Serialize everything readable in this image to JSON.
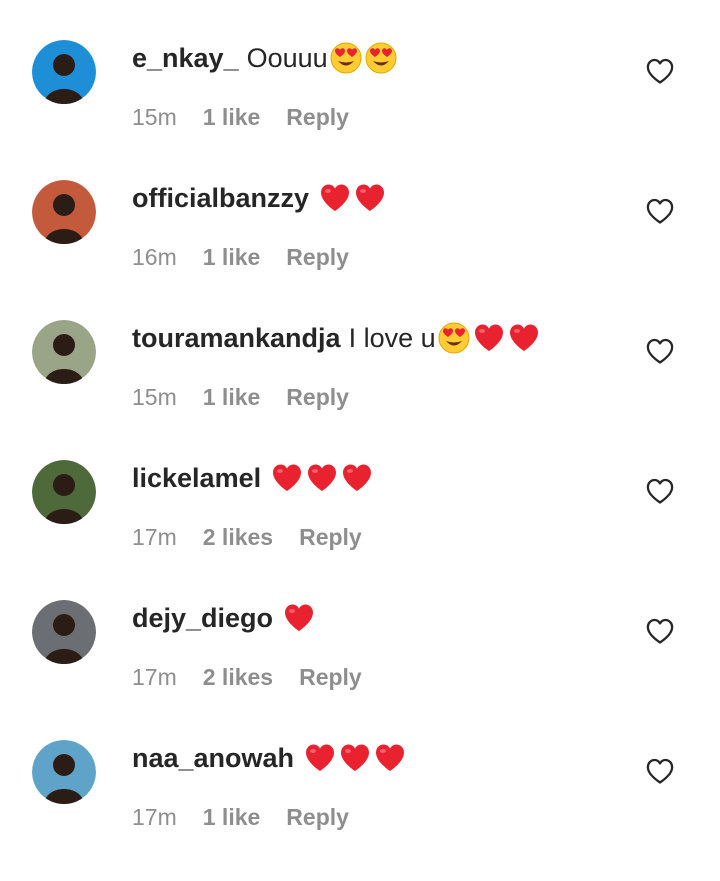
{
  "comments": [
    {
      "username": "e_nkay_",
      "text": "Oouuu",
      "emojis": [
        "heart-eyes",
        "heart-eyes"
      ],
      "time": "15m",
      "likes": "1 like",
      "reply": "Reply",
      "avatar_bg": "#1e8fd6"
    },
    {
      "username": "officialbanzzy",
      "text": "",
      "emojis": [
        "heart",
        "heart"
      ],
      "time": "16m",
      "likes": "1 like",
      "reply": "Reply",
      "avatar_bg": "#c45a3c"
    },
    {
      "username": "touramankandja",
      "text": "I love u",
      "emojis": [
        "heart-eyes",
        "heart",
        "heart"
      ],
      "time": "15m",
      "likes": "1 like",
      "reply": "Reply",
      "avatar_bg": "#9aa588"
    },
    {
      "username": "lickelamel",
      "text": "",
      "emojis": [
        "heart",
        "heart",
        "heart"
      ],
      "time": "17m",
      "likes": "2 likes",
      "reply": "Reply",
      "avatar_bg": "#4f6a3a"
    },
    {
      "username": "dejy_diego",
      "text": "",
      "emojis": [
        "heart"
      ],
      "time": "17m",
      "likes": "2 likes",
      "reply": "Reply",
      "avatar_bg": "#6b6f73"
    },
    {
      "username": "naa_anowah",
      "text": "",
      "emojis": [
        "heart",
        "heart",
        "heart"
      ],
      "time": "17m",
      "likes": "1 like",
      "reply": "Reply",
      "avatar_bg": "#5fa3c8"
    }
  ],
  "colors": {
    "primary_text": "#262626",
    "secondary_text": "#8e8e8e",
    "heart_red": "#e8232f"
  },
  "icons": {
    "like": "heart-outline-icon",
    "emoji_heart": "red-heart-emoji",
    "emoji_face": "heart-eyes-emoji"
  }
}
